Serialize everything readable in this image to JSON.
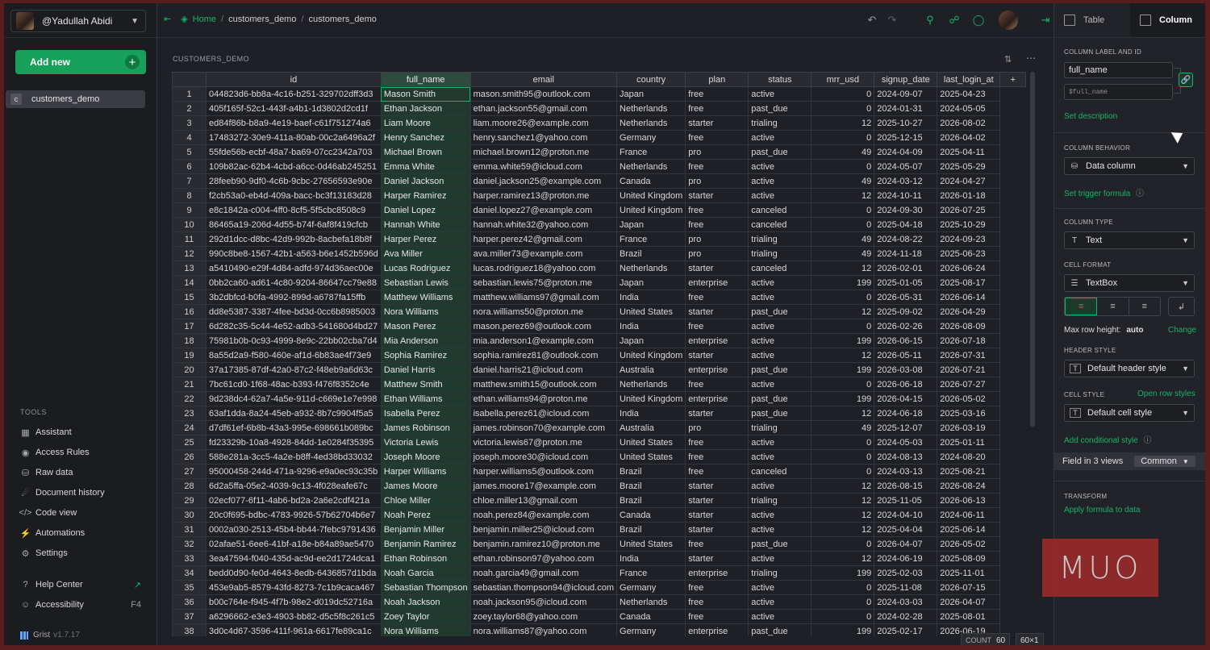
{
  "sidebar": {
    "user": "@Yadullah Abidi",
    "add_new": "Add new",
    "page": "customers_demo",
    "page_icon": "c",
    "tools_title": "TOOLS",
    "tools": [
      {
        "label": "Assistant",
        "icon": "assistant-icon"
      },
      {
        "label": "Access Rules",
        "icon": "access-rules-icon"
      },
      {
        "label": "Raw data",
        "icon": "raw-data-icon"
      },
      {
        "label": "Document history",
        "icon": "history-icon"
      },
      {
        "label": "Code view",
        "icon": "code-icon"
      },
      {
        "label": "Automations",
        "icon": "automations-icon"
      },
      {
        "label": "Settings",
        "icon": "settings-icon"
      }
    ],
    "help_center": "Help Center",
    "accessibility": "Accessibility",
    "accessibility_shortcut": "F4",
    "version_brand": "Grist",
    "version": "v1.7.17"
  },
  "topbar": {
    "home": "Home",
    "crumb1": "customers_demo",
    "crumb2": "customers_demo"
  },
  "section": {
    "title": "CUSTOMERS_DEMO",
    "count_label": "COUNT",
    "count_value": "60",
    "dims": "60×1"
  },
  "table": {
    "columns": [
      "id",
      "full_name",
      "email",
      "country",
      "plan",
      "status",
      "mrr_usd",
      "signup_date",
      "last_login_at"
    ],
    "add_column": "+",
    "rows": [
      [
        "1",
        "044823d6-bb8a-4c16-b251-329702dff3d3",
        "Mason Smith",
        "mason.smith95@outlook.com",
        "Japan",
        "free",
        "active",
        "0",
        "2024-09-07",
        "2025-04-23"
      ],
      [
        "2",
        "405f165f-52c1-443f-a4b1-1d3802d2cd1f",
        "Ethan Jackson",
        "ethan.jackson55@gmail.com",
        "Netherlands",
        "free",
        "past_due",
        "0",
        "2024-01-31",
        "2024-05-05"
      ],
      [
        "3",
        "ed84f86b-b8a9-4e19-baef-c61f751274a6",
        "Liam Moore",
        "liam.moore26@example.com",
        "Netherlands",
        "starter",
        "trialing",
        "12",
        "2025-10-27",
        "2026-08-02"
      ],
      [
        "4",
        "17483272-30e9-411a-80ab-00c2a6496a2f",
        "Henry Sanchez",
        "henry.sanchez1@yahoo.com",
        "Germany",
        "free",
        "active",
        "0",
        "2025-12-15",
        "2026-04-02"
      ],
      [
        "5",
        "55fde56b-ecbf-48a7-ba69-07cc2342a703",
        "Michael Brown",
        "michael.brown12@proton.me",
        "France",
        "pro",
        "past_due",
        "49",
        "2024-04-09",
        "2025-04-11"
      ],
      [
        "6",
        "109b82ac-62b4-4cbd-a6cc-0d46ab245251",
        "Emma White",
        "emma.white59@icloud.com",
        "Netherlands",
        "free",
        "active",
        "0",
        "2024-05-07",
        "2025-05-29"
      ],
      [
        "7",
        "28feeb90-9df0-4c6b-9cbc-27656593e90e",
        "Daniel Jackson",
        "daniel.jackson25@example.com",
        "Canada",
        "pro",
        "active",
        "49",
        "2024-03-12",
        "2024-04-27"
      ],
      [
        "8",
        "f2cb53a0-eb4d-409a-bacc-bc3f13183d28",
        "Harper Ramirez",
        "harper.ramirez13@proton.me",
        "United Kingdom",
        "starter",
        "active",
        "12",
        "2024-10-11",
        "2026-01-18"
      ],
      [
        "9",
        "e8c1842a-c004-4ff0-8cf5-5f5cbc8508c9",
        "Daniel Lopez",
        "daniel.lopez27@example.com",
        "United Kingdom",
        "free",
        "canceled",
        "0",
        "2024-09-30",
        "2026-07-25"
      ],
      [
        "10",
        "86465a19-206d-4d55-b74f-6af8f419cfcb",
        "Hannah White",
        "hannah.white32@yahoo.com",
        "Japan",
        "free",
        "canceled",
        "0",
        "2025-04-18",
        "2025-10-29"
      ],
      [
        "11",
        "292d1dcc-d8bc-42d9-992b-8acbefa18b8f",
        "Harper Perez",
        "harper.perez42@gmail.com",
        "France",
        "pro",
        "trialing",
        "49",
        "2024-08-22",
        "2024-09-23"
      ],
      [
        "12",
        "990c8be8-1567-42b1-a563-b6e1452b596d",
        "Ava Miller",
        "ava.miller73@example.com",
        "Brazil",
        "pro",
        "trialing",
        "49",
        "2024-11-18",
        "2025-06-23"
      ],
      [
        "13",
        "a5410490-e29f-4d84-adfd-974d36aec00e",
        "Lucas Rodriguez",
        "lucas.rodriguez18@yahoo.com",
        "Netherlands",
        "starter",
        "canceled",
        "12",
        "2026-02-01",
        "2026-06-24"
      ],
      [
        "14",
        "0bb2ca60-ad61-4c80-9204-86647cc79e88",
        "Sebastian Lewis",
        "sebastian.lewis75@proton.me",
        "Japan",
        "enterprise",
        "active",
        "199",
        "2025-01-05",
        "2025-08-17"
      ],
      [
        "15",
        "3b2dbfcd-b0fa-4992-899d-a6787fa15ffb",
        "Matthew Williams",
        "matthew.williams97@gmail.com",
        "India",
        "free",
        "active",
        "0",
        "2026-05-31",
        "2026-06-14"
      ],
      [
        "16",
        "dd8e5387-3387-4fee-bd3d-0cc6b8985003",
        "Nora Williams",
        "nora.williams50@proton.me",
        "United States",
        "starter",
        "past_due",
        "12",
        "2025-09-02",
        "2026-04-29"
      ],
      [
        "17",
        "6d282c35-5c44-4e52-adb3-541680d4bd27",
        "Mason Perez",
        "mason.perez69@outlook.com",
        "India",
        "free",
        "active",
        "0",
        "2026-02-26",
        "2026-08-09"
      ],
      [
        "18",
        "75981b0b-0c93-4999-8e9c-22bb02cba7d4",
        "Mia Anderson",
        "mia.anderson1@example.com",
        "Japan",
        "enterprise",
        "active",
        "199",
        "2026-06-15",
        "2026-07-18"
      ],
      [
        "19",
        "8a55d2a9-f580-460e-af1d-6b83ae4f73e9",
        "Sophia Ramirez",
        "sophia.ramirez81@outlook.com",
        "United Kingdom",
        "starter",
        "active",
        "12",
        "2026-05-11",
        "2026-07-31"
      ],
      [
        "20",
        "37a17385-87df-42a0-87c2-f48eb9a6d63c",
        "Daniel Harris",
        "daniel.harris21@icloud.com",
        "Australia",
        "enterprise",
        "past_due",
        "199",
        "2026-03-08",
        "2026-07-21"
      ],
      [
        "21",
        "7bc61cd0-1f68-48ac-b393-f476f8352c4e",
        "Matthew Smith",
        "matthew.smith15@outlook.com",
        "Netherlands",
        "free",
        "active",
        "0",
        "2026-06-18",
        "2026-07-27"
      ],
      [
        "22",
        "9d238dc4-62a7-4a5e-911d-c669e1e7e998",
        "Ethan Williams",
        "ethan.williams94@proton.me",
        "United Kingdom",
        "enterprise",
        "past_due",
        "199",
        "2026-04-15",
        "2026-05-02"
      ],
      [
        "23",
        "63af1dda-8a24-45eb-a932-8b7c9904f5a5",
        "Isabella Perez",
        "isabella.perez61@icloud.com",
        "India",
        "starter",
        "past_due",
        "12",
        "2024-06-18",
        "2025-03-16"
      ],
      [
        "24",
        "d7df61ef-6b8b-43a3-995e-698661b089bc",
        "James Robinson",
        "james.robinson70@example.com",
        "Australia",
        "pro",
        "trialing",
        "49",
        "2025-12-07",
        "2026-03-19"
      ],
      [
        "25",
        "fd23329b-10a8-4928-84dd-1e0284f35395",
        "Victoria Lewis",
        "victoria.lewis67@proton.me",
        "United States",
        "free",
        "active",
        "0",
        "2024-05-03",
        "2025-01-11"
      ],
      [
        "26",
        "588e281a-3cc5-4a2e-b8ff-4ed38bd33032",
        "Joseph Moore",
        "joseph.moore30@icloud.com",
        "United States",
        "free",
        "active",
        "0",
        "2024-08-13",
        "2024-08-20"
      ],
      [
        "27",
        "95000458-244d-471a-9296-e9a0ec93c35b",
        "Harper Williams",
        "harper.williams5@outlook.com",
        "Brazil",
        "free",
        "canceled",
        "0",
        "2024-03-13",
        "2025-08-21"
      ],
      [
        "28",
        "6d2a5ffa-05e2-4039-9c13-4f028eafe67c",
        "James Moore",
        "james.moore17@example.com",
        "Brazil",
        "starter",
        "active",
        "12",
        "2026-08-15",
        "2026-08-24"
      ],
      [
        "29",
        "02ecf077-6f11-4ab6-bd2a-2a6e2cdf421a",
        "Chloe Miller",
        "chloe.miller13@gmail.com",
        "Brazil",
        "starter",
        "trialing",
        "12",
        "2025-11-05",
        "2026-06-13"
      ],
      [
        "30",
        "20c0f695-bdbc-4783-9926-57b62704b6e7",
        "Noah Perez",
        "noah.perez84@example.com",
        "Canada",
        "starter",
        "active",
        "12",
        "2024-04-10",
        "2024-06-11"
      ],
      [
        "31",
        "0002a030-2513-45b4-bb44-7febc9791436",
        "Benjamin Miller",
        "benjamin.miller25@icloud.com",
        "Brazil",
        "starter",
        "active",
        "12",
        "2025-04-04",
        "2025-06-14"
      ],
      [
        "32",
        "02afae51-6ee6-41bf-a18e-b84a89ae5470",
        "Benjamin Ramirez",
        "benjamin.ramirez10@proton.me",
        "United States",
        "free",
        "past_due",
        "0",
        "2026-04-07",
        "2026-05-02"
      ],
      [
        "33",
        "3ea47594-f040-435d-ac9d-ee2d1724dca1",
        "Ethan Robinson",
        "ethan.robinson97@yahoo.com",
        "India",
        "starter",
        "active",
        "12",
        "2024-06-19",
        "2025-08-09"
      ],
      [
        "34",
        "bedd0d90-fe0d-4643-8edb-6436857d1bda",
        "Noah Garcia",
        "noah.garcia49@gmail.com",
        "France",
        "enterprise",
        "trialing",
        "199",
        "2025-02-03",
        "2025-11-01"
      ],
      [
        "35",
        "453e9ab5-8579-43fd-8273-7c1b9caca467",
        "Sebastian Thompson",
        "sebastian.thompson94@icloud.com",
        "Germany",
        "free",
        "active",
        "0",
        "2025-11-08",
        "2026-07-15"
      ],
      [
        "36",
        "b00c764e-f945-4f7b-98e2-d019dc52716a",
        "Noah Jackson",
        "noah.jackson95@icloud.com",
        "Netherlands",
        "free",
        "active",
        "0",
        "2024-03-03",
        "2026-04-07"
      ],
      [
        "37",
        "a6296662-e3e3-4903-bb82-d5c5f8c261c5",
        "Zoey Taylor",
        "zoey.taylor68@yahoo.com",
        "Canada",
        "free",
        "active",
        "0",
        "2024-02-28",
        "2025-08-01"
      ],
      [
        "38",
        "3d0c4d67-3596-411f-961a-6617fe89ca1c",
        "Nora Williams",
        "nora.williams87@yahoo.com",
        "Germany",
        "enterprise",
        "past_due",
        "199",
        "2025-02-17",
        "2026-06-19"
      ]
    ]
  },
  "right_panel": {
    "tab_table": "Table",
    "tab_column": "Column",
    "label_id_title": "COLUMN LABEL AND ID",
    "label_value": "full_name",
    "id_value": "$full_name",
    "set_description": "Set description",
    "behavior_title": "COLUMN BEHAVIOR",
    "behavior_value": "Data column",
    "set_trigger": "Set trigger formula",
    "type_title": "COLUMN TYPE",
    "type_value": "Text",
    "cell_format_title": "CELL FORMAT",
    "cell_format_value": "TextBox",
    "max_row_height_label": "Max row height:",
    "max_row_height_value": "auto",
    "change": "Change",
    "header_style_title": "HEADER STYLE",
    "header_style_value": "Default header style",
    "cell_style_title": "CELL STYLE",
    "open_row_styles": "Open row styles",
    "cell_style_value": "Default cell style",
    "add_conditional_style": "Add conditional style",
    "field_in": "Field in 3 views",
    "common": "Common",
    "transform_title": "TRANSFORM",
    "apply_formula": "Apply formula to data"
  },
  "watermark": "MUO",
  "colors": {
    "accent": "#16b36a",
    "button_green": "#16a05a",
    "background": "#1f2025"
  }
}
